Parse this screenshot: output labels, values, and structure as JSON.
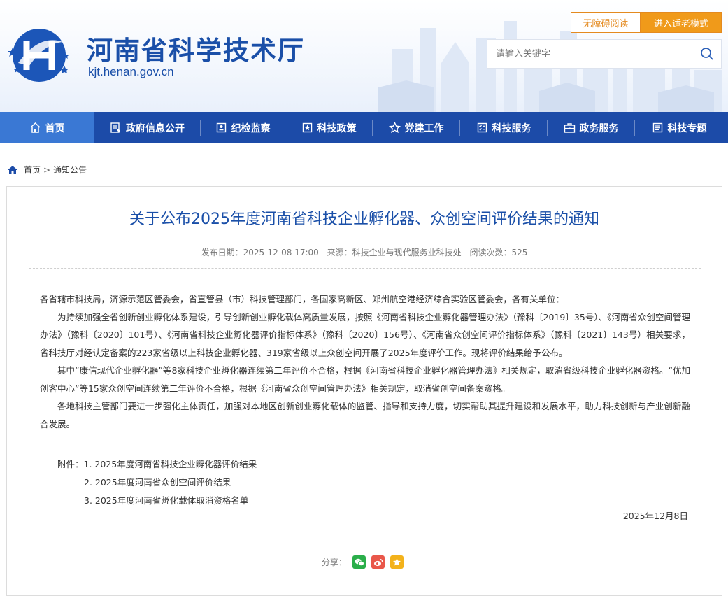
{
  "header": {
    "site_title": "河南省科学技术厅",
    "site_url": "kjt.henan.gov.cn",
    "accessibility_label": "无障碍阅读",
    "elder_mode_label": "进入适老模式",
    "search_placeholder": "请输入关键字"
  },
  "nav": {
    "items": [
      {
        "label": "首页",
        "icon": "home-icon"
      },
      {
        "label": "政府信息公开",
        "icon": "document-icon"
      },
      {
        "label": "纪检监察",
        "icon": "clipboard-icon"
      },
      {
        "label": "科技政策",
        "icon": "badge-icon"
      },
      {
        "label": "党建工作",
        "icon": "star-icon"
      },
      {
        "label": "科技服务",
        "icon": "checklist-icon"
      },
      {
        "label": "政务服务",
        "icon": "briefcase-icon"
      },
      {
        "label": "科技专题",
        "icon": "list-icon"
      }
    ]
  },
  "breadcrumb": {
    "home": "首页",
    "separator": ">",
    "current": "通知公告"
  },
  "article": {
    "title": "关于公布2025年度河南省科技企业孵化器、众创空间评价结果的通知",
    "publish_date": "发布日期：2025-12-08 17:00",
    "source": "来源：科技企业与现代服务业科技处",
    "views": "阅读次数：525",
    "salutation": "各省辖市科技局，济源示范区管委会，省直管县（市）科技管理部门，各国家高新区、郑州航空港经济综合实验区管委会，各有关单位：",
    "para1": "为持续加强全省创新创业孵化体系建设，引导创新创业孵化载体高质量发展，按照《河南省科技企业孵化器管理办法》（豫科〔2019〕35号）、《河南省众创空间管理办法》（豫科〔2020〕101号）、《河南省科技企业孵化器评价指标体系》（豫科〔2020〕156号）、《河南省众创空间评价指标体系》（豫科〔2021〕143号）相关要求，省科技厅对经认定备案的223家省级以上科技企业孵化器、319家省级以上众创空间开展了2025年度评价工作。现将评价结果给予公布。",
    "para2": "其中“康信现代企业孵化器”等8家科技企业孵化器连续第二年评价不合格，根据《河南省科技企业孵化器管理办法》相关规定，取消省级科技企业孵化器资格。“优加创客中心”等15家众创空间连续第二年评价不合格，根据《河南省众创空间管理办法》相关规定，取消省创空间备案资格。",
    "para3": "各地科技主管部门要进一步强化主体责任，加强对本地区创新创业孵化载体的监管、指导和支持力度，切实帮助其提升建设和发展水平，助力科技创新与产业创新融合发展。",
    "attachments": [
      "附件：1. 2025年度河南省科技企业孵化器评价结果",
      "2. 2025年度河南省众创空间评价结果",
      "3. 2025年度河南省孵化载体取消资格名单"
    ],
    "date": "2025年12月8日",
    "share_label": "分享："
  },
  "colors": {
    "brand_blue": "#1c4ba8",
    "nav_active": "#3a78d4",
    "accent_orange": "#f09a1a",
    "wechat": "#2aae4a",
    "weibo": "#e9574a",
    "qzone": "#f3b21b"
  }
}
